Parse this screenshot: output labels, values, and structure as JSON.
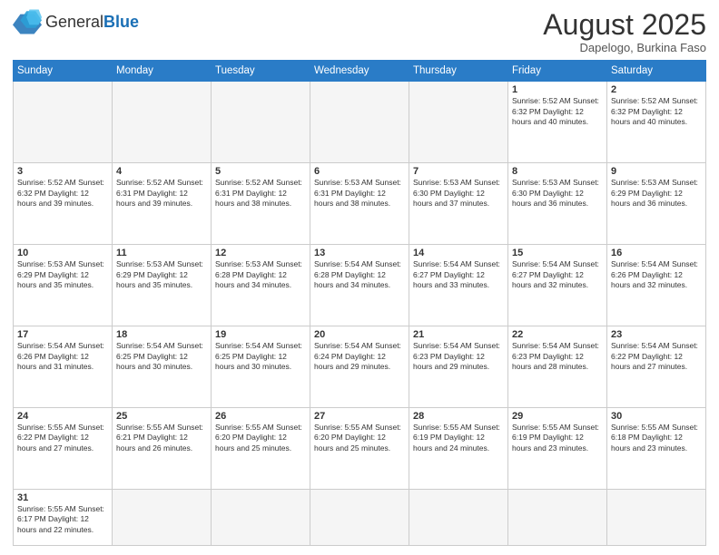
{
  "header": {
    "logo_general": "General",
    "logo_blue": "Blue",
    "month_title": "August 2025",
    "location": "Dapelogo, Burkina Faso"
  },
  "weekdays": [
    "Sunday",
    "Monday",
    "Tuesday",
    "Wednesday",
    "Thursday",
    "Friday",
    "Saturday"
  ],
  "weeks": [
    [
      {
        "day": "",
        "info": ""
      },
      {
        "day": "",
        "info": ""
      },
      {
        "day": "",
        "info": ""
      },
      {
        "day": "",
        "info": ""
      },
      {
        "day": "",
        "info": ""
      },
      {
        "day": "1",
        "info": "Sunrise: 5:52 AM\nSunset: 6:32 PM\nDaylight: 12 hours and 40 minutes."
      },
      {
        "day": "2",
        "info": "Sunrise: 5:52 AM\nSunset: 6:32 PM\nDaylight: 12 hours and 40 minutes."
      }
    ],
    [
      {
        "day": "3",
        "info": "Sunrise: 5:52 AM\nSunset: 6:32 PM\nDaylight: 12 hours and 39 minutes."
      },
      {
        "day": "4",
        "info": "Sunrise: 5:52 AM\nSunset: 6:31 PM\nDaylight: 12 hours and 39 minutes."
      },
      {
        "day": "5",
        "info": "Sunrise: 5:52 AM\nSunset: 6:31 PM\nDaylight: 12 hours and 38 minutes."
      },
      {
        "day": "6",
        "info": "Sunrise: 5:53 AM\nSunset: 6:31 PM\nDaylight: 12 hours and 38 minutes."
      },
      {
        "day": "7",
        "info": "Sunrise: 5:53 AM\nSunset: 6:30 PM\nDaylight: 12 hours and 37 minutes."
      },
      {
        "day": "8",
        "info": "Sunrise: 5:53 AM\nSunset: 6:30 PM\nDaylight: 12 hours and 36 minutes."
      },
      {
        "day": "9",
        "info": "Sunrise: 5:53 AM\nSunset: 6:29 PM\nDaylight: 12 hours and 36 minutes."
      }
    ],
    [
      {
        "day": "10",
        "info": "Sunrise: 5:53 AM\nSunset: 6:29 PM\nDaylight: 12 hours and 35 minutes."
      },
      {
        "day": "11",
        "info": "Sunrise: 5:53 AM\nSunset: 6:29 PM\nDaylight: 12 hours and 35 minutes."
      },
      {
        "day": "12",
        "info": "Sunrise: 5:53 AM\nSunset: 6:28 PM\nDaylight: 12 hours and 34 minutes."
      },
      {
        "day": "13",
        "info": "Sunrise: 5:54 AM\nSunset: 6:28 PM\nDaylight: 12 hours and 34 minutes."
      },
      {
        "day": "14",
        "info": "Sunrise: 5:54 AM\nSunset: 6:27 PM\nDaylight: 12 hours and 33 minutes."
      },
      {
        "day": "15",
        "info": "Sunrise: 5:54 AM\nSunset: 6:27 PM\nDaylight: 12 hours and 32 minutes."
      },
      {
        "day": "16",
        "info": "Sunrise: 5:54 AM\nSunset: 6:26 PM\nDaylight: 12 hours and 32 minutes."
      }
    ],
    [
      {
        "day": "17",
        "info": "Sunrise: 5:54 AM\nSunset: 6:26 PM\nDaylight: 12 hours and 31 minutes."
      },
      {
        "day": "18",
        "info": "Sunrise: 5:54 AM\nSunset: 6:25 PM\nDaylight: 12 hours and 30 minutes."
      },
      {
        "day": "19",
        "info": "Sunrise: 5:54 AM\nSunset: 6:25 PM\nDaylight: 12 hours and 30 minutes."
      },
      {
        "day": "20",
        "info": "Sunrise: 5:54 AM\nSunset: 6:24 PM\nDaylight: 12 hours and 29 minutes."
      },
      {
        "day": "21",
        "info": "Sunrise: 5:54 AM\nSunset: 6:23 PM\nDaylight: 12 hours and 29 minutes."
      },
      {
        "day": "22",
        "info": "Sunrise: 5:54 AM\nSunset: 6:23 PM\nDaylight: 12 hours and 28 minutes."
      },
      {
        "day": "23",
        "info": "Sunrise: 5:54 AM\nSunset: 6:22 PM\nDaylight: 12 hours and 27 minutes."
      }
    ],
    [
      {
        "day": "24",
        "info": "Sunrise: 5:55 AM\nSunset: 6:22 PM\nDaylight: 12 hours and 27 minutes."
      },
      {
        "day": "25",
        "info": "Sunrise: 5:55 AM\nSunset: 6:21 PM\nDaylight: 12 hours and 26 minutes."
      },
      {
        "day": "26",
        "info": "Sunrise: 5:55 AM\nSunset: 6:20 PM\nDaylight: 12 hours and 25 minutes."
      },
      {
        "day": "27",
        "info": "Sunrise: 5:55 AM\nSunset: 6:20 PM\nDaylight: 12 hours and 25 minutes."
      },
      {
        "day": "28",
        "info": "Sunrise: 5:55 AM\nSunset: 6:19 PM\nDaylight: 12 hours and 24 minutes."
      },
      {
        "day": "29",
        "info": "Sunrise: 5:55 AM\nSunset: 6:19 PM\nDaylight: 12 hours and 23 minutes."
      },
      {
        "day": "30",
        "info": "Sunrise: 5:55 AM\nSunset: 6:18 PM\nDaylight: 12 hours and 23 minutes."
      }
    ],
    [
      {
        "day": "31",
        "info": "Sunrise: 5:55 AM\nSunset: 6:17 PM\nDaylight: 12 hours and 22 minutes."
      },
      {
        "day": "",
        "info": ""
      },
      {
        "day": "",
        "info": ""
      },
      {
        "day": "",
        "info": ""
      },
      {
        "day": "",
        "info": ""
      },
      {
        "day": "",
        "info": ""
      },
      {
        "day": "",
        "info": ""
      }
    ]
  ],
  "colors": {
    "header_bg": "#2a7cc7",
    "border": "#cccccc",
    "empty_bg": "#f5f5f5"
  }
}
